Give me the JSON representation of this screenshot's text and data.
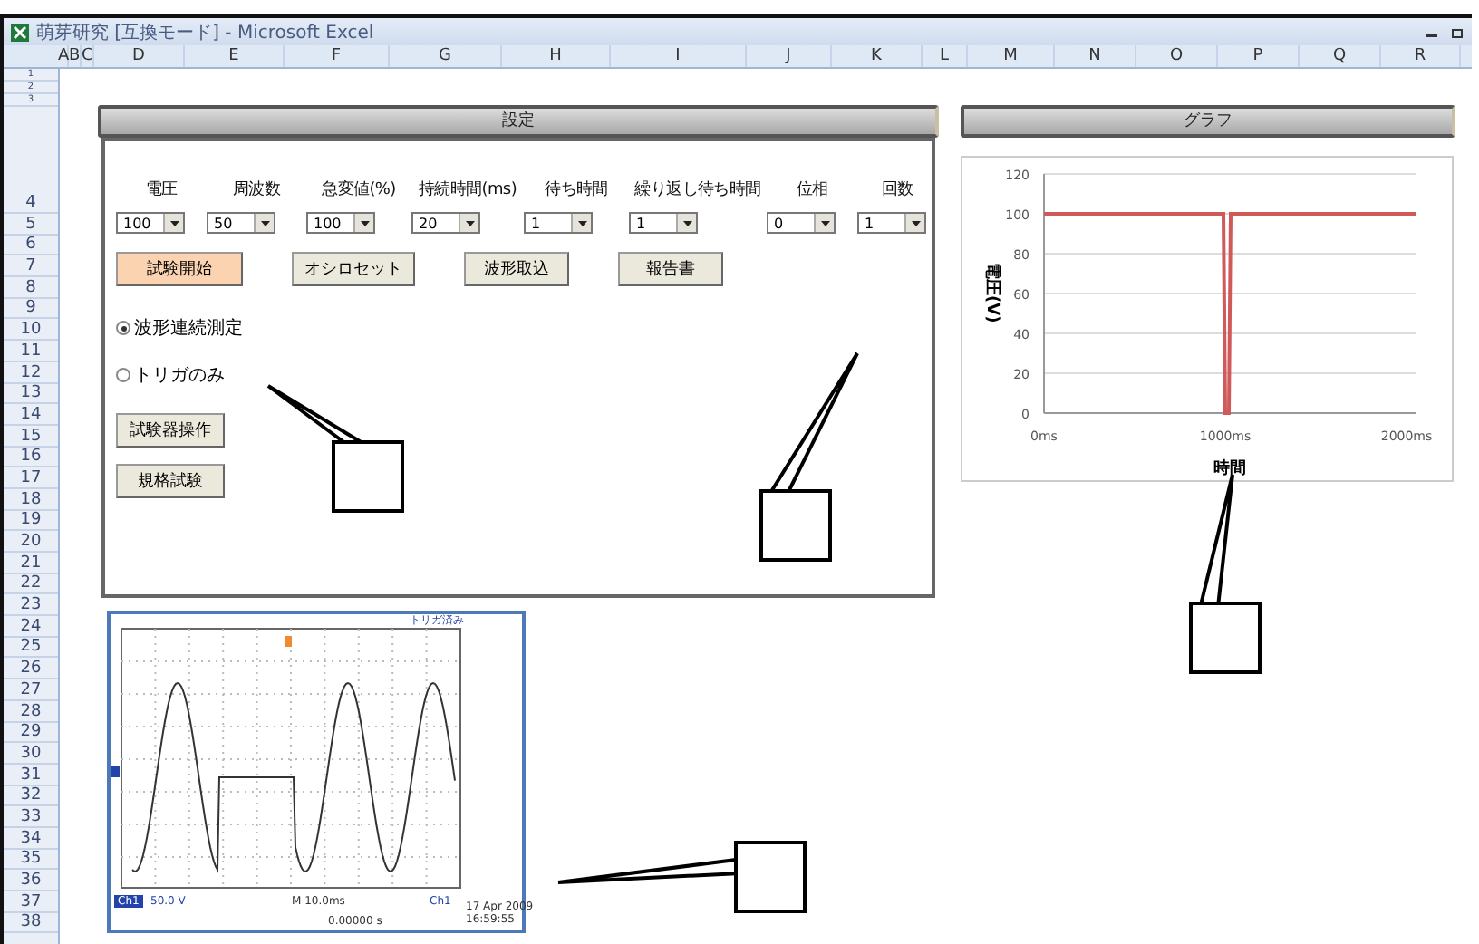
{
  "window": {
    "title": "萌芽研究 [互換モード] - Microsoft Excel"
  },
  "columns": [
    "A",
    "B",
    "C",
    "D",
    "E",
    "F",
    "G",
    "H",
    "I",
    "J",
    "K",
    "L",
    "M",
    "N",
    "O",
    "P",
    "Q",
    "R"
  ],
  "rows": [
    "1",
    "2",
    "3",
    "4",
    "5",
    "6",
    "7",
    "8",
    "9",
    "10",
    "11",
    "12",
    "13",
    "14",
    "15",
    "16",
    "17",
    "18",
    "19",
    "20",
    "21",
    "22",
    "23",
    "24",
    "25",
    "26",
    "27",
    "28",
    "29",
    "30",
    "31",
    "32",
    "33",
    "34",
    "35",
    "36",
    "37",
    "38"
  ],
  "settings_panel": {
    "title": "設定",
    "fields": [
      {
        "label": "電圧",
        "value": "100"
      },
      {
        "label": "周波数",
        "value": "50"
      },
      {
        "label": "急変値(%)",
        "value": "100"
      },
      {
        "label": "持続時間(ms)",
        "value": "20"
      },
      {
        "label": "待ち時間",
        "value": "1"
      },
      {
        "label": "繰り返し待ち時間",
        "value": "1"
      },
      {
        "label": "位相",
        "value": "0"
      },
      {
        "label": "回数",
        "value": "1"
      }
    ],
    "buttons": [
      {
        "label": "試験開始",
        "highlighted": true
      },
      {
        "label": "オシロセット",
        "highlighted": false
      },
      {
        "label": "波形取込",
        "highlighted": false
      },
      {
        "label": "報告書",
        "highlighted": false
      }
    ],
    "radios": [
      {
        "label": "波形連続測定",
        "selected": true
      },
      {
        "label": "トリガのみ",
        "selected": false
      }
    ],
    "side_buttons": [
      "試験器操作",
      "規格試験"
    ]
  },
  "graph_panel": {
    "title": "グラフ",
    "chart_data": {
      "type": "line",
      "xlabel": "時間",
      "ylabel": "電圧(V)",
      "grid": true,
      "x": [
        0,
        990,
        1000,
        1020,
        1030,
        2050
      ],
      "series": [
        {
          "color": "#d05a5a",
          "values": [
            100,
            100,
            0,
            0,
            100,
            100
          ]
        }
      ],
      "xlim": [
        0,
        2050
      ],
      "ylim": [
        0,
        120
      ],
      "xticks": [
        {
          "value": 0,
          "label": "0ms"
        },
        {
          "value": 1000,
          "label": "1000ms"
        },
        {
          "value": 2000,
          "label": "2000ms"
        }
      ],
      "yticks": [
        0,
        20,
        40,
        60,
        80,
        100,
        120
      ]
    }
  },
  "scope": {
    "status": "トリガ済み",
    "channel": "Ch1",
    "volts": "50.0 V",
    "timebase": "M 10.0ms",
    "source": "Ch1",
    "offset": "0.00000 s",
    "date": "17 Apr 2009",
    "time": "16:59:55"
  }
}
